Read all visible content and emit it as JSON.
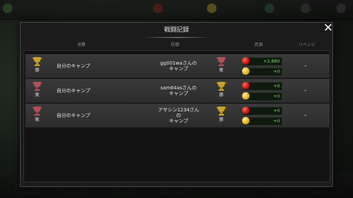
{
  "dialog": {
    "title": "戦闘記録",
    "close_icon": "close-x-icon"
  },
  "columns": {
    "attack": "攻撃",
    "defense": "防御",
    "resources": "資源",
    "revenge": "リベンジ"
  },
  "rows": [
    {
      "attacker_result": "勝",
      "attacker_icon": "gold-trophy-icon",
      "attacker": "自分のキャンプ",
      "defender": "gg001waさんの\nキャンプ",
      "defender_result": "敗",
      "defender_icon": "red-trophy-icon",
      "apples": "+2,880",
      "coins": "+0",
      "revenge": "-"
    },
    {
      "attacker_result": "敗",
      "attacker_icon": "red-trophy-icon",
      "attacker": "自分のキャンプ",
      "defender": "sam64asさんの\nキャンプ",
      "defender_result": "勝",
      "defender_icon": "gold-trophy-icon",
      "apples": "+0",
      "coins": "+0",
      "revenge": "-"
    },
    {
      "attacker_result": "敗",
      "attacker_icon": "red-trophy-icon",
      "attacker": "自分のキャンプ",
      "defender": "アサシン1234さん\nの\nキャンプ",
      "defender_result": "勝",
      "defender_icon": "gold-trophy-icon",
      "apples": "+0",
      "coins": "+0",
      "revenge": "-"
    }
  ],
  "colors": {
    "win": "#c9a227",
    "lose": "#b0505a",
    "resource_text": "#7fe05a"
  }
}
